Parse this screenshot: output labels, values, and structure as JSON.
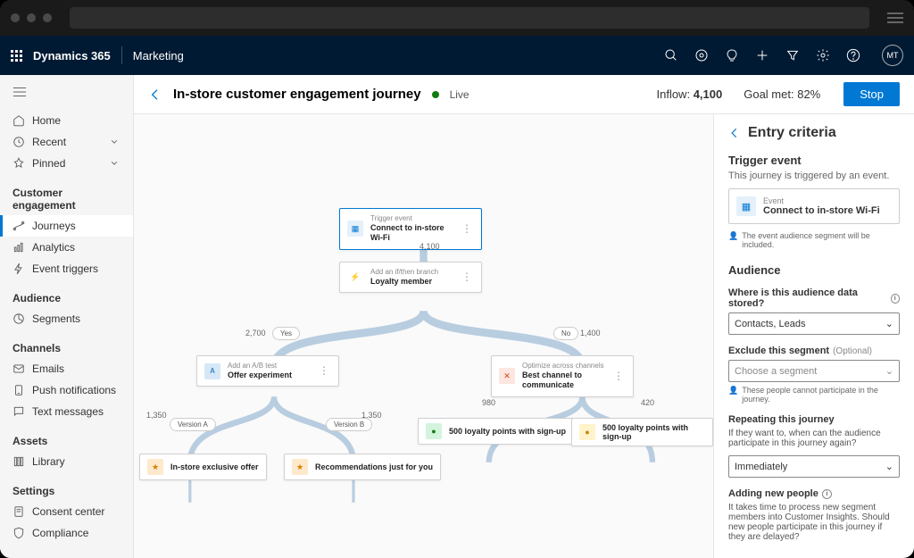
{
  "topbar": {
    "product": "Dynamics 365",
    "module": "Marketing",
    "avatar": "MT"
  },
  "sidebar": {
    "top": [
      {
        "label": "Home",
        "icon": "home"
      },
      {
        "label": "Recent",
        "icon": "clock",
        "chevron": true
      },
      {
        "label": "Pinned",
        "icon": "pin",
        "chevron": true
      }
    ],
    "groups": [
      {
        "title": "Customer engagement",
        "items": [
          {
            "label": "Journeys",
            "icon": "journey",
            "active": true
          },
          {
            "label": "Analytics",
            "icon": "analytics"
          },
          {
            "label": "Event triggers",
            "icon": "trigger"
          }
        ]
      },
      {
        "title": "Audience",
        "items": [
          {
            "label": "Segments",
            "icon": "segments"
          }
        ]
      },
      {
        "title": "Channels",
        "items": [
          {
            "label": "Emails",
            "icon": "email"
          },
          {
            "label": "Push notifications",
            "icon": "push"
          },
          {
            "label": "Text messages",
            "icon": "sms"
          }
        ]
      },
      {
        "title": "Assets",
        "items": [
          {
            "label": "Library",
            "icon": "library"
          }
        ]
      },
      {
        "title": "Settings",
        "items": [
          {
            "label": "Consent center",
            "icon": "consent"
          },
          {
            "label": "Compliance",
            "icon": "compliance"
          }
        ]
      }
    ]
  },
  "header": {
    "title": "In-store customer engagement journey",
    "status": "Live",
    "inflow_label": "Inflow:",
    "inflow_value": "4,100",
    "goal_label": "Goal met:",
    "goal_value": "82%",
    "stop": "Stop"
  },
  "canvas": {
    "trigger": {
      "label": "Trigger event",
      "title": "Connect to in-store Wi-Fi"
    },
    "count_trigger": "4,100",
    "branch": {
      "label": "Add an if/then branch",
      "title": "Loyalty member"
    },
    "yes_count": "2,700",
    "yes_label": "Yes",
    "no_count": "1,400",
    "no_label": "No",
    "ab": {
      "label": "Add an A/B test",
      "title": "Offer experiment"
    },
    "opt": {
      "label": "Optimize across channels",
      "title": "Best channel to communicate"
    },
    "va_count": "1,350",
    "va_label": "Version A",
    "vb_count": "1,350",
    "vb_label": "Version B",
    "ch1_count": "980",
    "ch2_count": "420",
    "leaf_a": "In-store exclusive offer",
    "leaf_b": "Recommendations just for you",
    "leaf_c": "500 loyalty points with sign-up",
    "leaf_d": "500 loyalty points with sign-up"
  },
  "panel": {
    "title": "Entry criteria",
    "trigger_heading": "Trigger event",
    "trigger_sub": "This journey is triggered by an event.",
    "event_label": "Event",
    "event_title": "Connect to in-store Wi-Fi",
    "event_note": "The event audience segment will be included.",
    "audience_heading": "Audience",
    "stored_label": "Where is this audience data stored?",
    "stored_value": "Contacts, Leads",
    "exclude_label": "Exclude this segment",
    "exclude_optional": "(Optional)",
    "exclude_placeholder": "Choose a segment",
    "exclude_note": "These people cannot participate in the journey.",
    "repeat_label": "Repeating this journey",
    "repeat_helper": "If they want to, when can the audience participate in this journey again?",
    "repeat_value": "Immediately",
    "adding_label": "Adding new people",
    "adding_helper": "It takes time to process new segment members into Customer Insights. Should new people participate in this journey if they are delayed?"
  }
}
